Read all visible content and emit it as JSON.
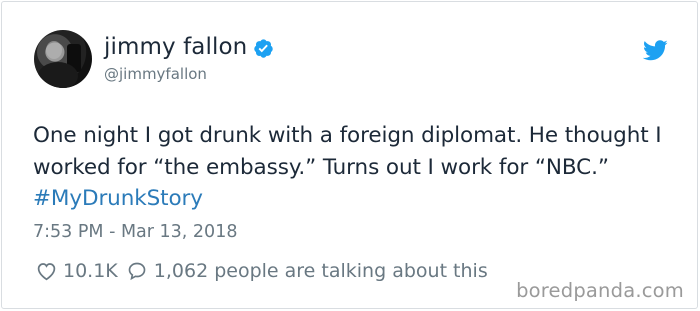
{
  "author": {
    "name": "jimmy fallon",
    "handle": "@jimmyfallon",
    "avatar_icon": "profile-photo",
    "verified_icon": "verified-badge-icon",
    "verified_color": "#1da1f2"
  },
  "tweet": {
    "text": "One night I got drunk with a foreign diplomat. He thought I worked for “the embassy.” Turns out I work for “NBC.”",
    "hashtag": "#MyDrunkStory",
    "timestamp": "7:53 PM - Mar 13, 2018"
  },
  "actions": {
    "likes": "10.1K",
    "talking": "1,062 people are talking about this",
    "like_icon": "heart-icon",
    "reply_icon": "speech-bubble-icon"
  },
  "brand": {
    "bird_icon": "twitter-bird-icon",
    "bird_color": "#1da1f2",
    "hashtag_color": "#2b7bb9"
  },
  "watermark": "boredpanda.com"
}
